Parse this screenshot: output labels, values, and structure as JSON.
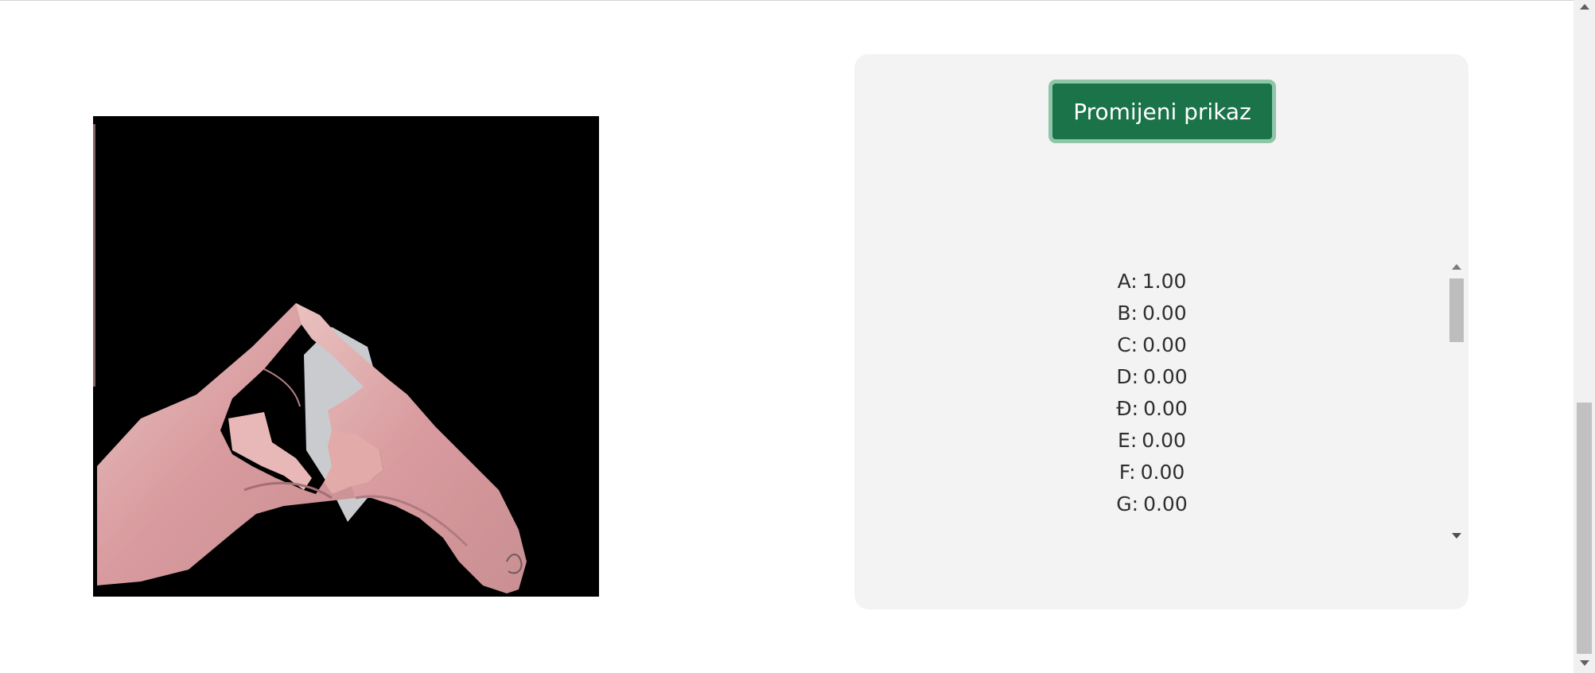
{
  "panel": {
    "toggle_button_label": "Promijeni prikaz"
  },
  "camera": {
    "image": "segmented-hand-sign-frame"
  },
  "predictions": [
    {
      "letter": "A",
      "score": "1.00"
    },
    {
      "letter": "B",
      "score": "0.00"
    },
    {
      "letter": "C",
      "score": "0.00"
    },
    {
      "letter": "D",
      "score": "0.00"
    },
    {
      "letter": "Đ",
      "score": "0.00"
    },
    {
      "letter": "E",
      "score": "0.00"
    },
    {
      "letter": "F",
      "score": "0.00"
    },
    {
      "letter": "G",
      "score": "0.00"
    }
  ],
  "colors": {
    "button_bg": "#1a7349",
    "button_border": "#8fc6a9",
    "panel_bg": "#f3f3f3"
  }
}
